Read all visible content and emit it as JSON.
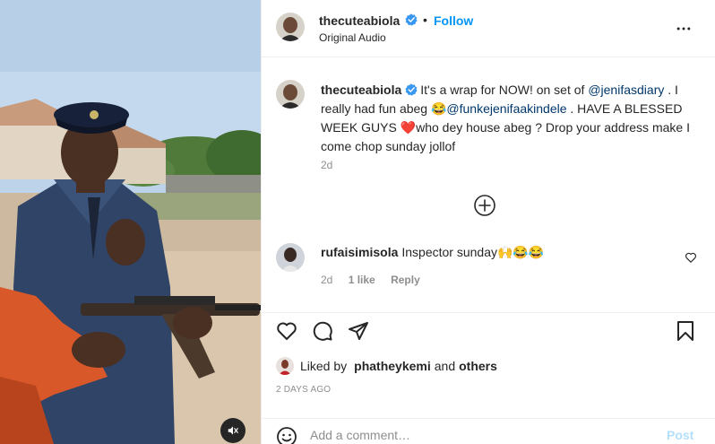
{
  "post": {
    "author": "thecuteabiola",
    "follow_label": "Follow",
    "separator": "•",
    "audio": "Original Audio",
    "more_icon": "more-horizontal-icon",
    "mute_icon": "speaker-muted-icon"
  },
  "caption": {
    "author": "thecuteabiola",
    "text_1": "It's a wrap for NOW! on set of ",
    "mention_1": "@jenifasdiary",
    "text_2": " . I really had fun abeg 😂",
    "mention_2": "@funkejenifaakindele",
    "text_3": " . HAVE A BLESSED WEEK GUYS ❤️who dey house abeg ? Drop your address make I come chop sunday jollof",
    "time": "2d",
    "load_more_icon": "plus-circle-icon"
  },
  "comment": {
    "author": "rufaisimisola",
    "text": "Inspector sunday🙌😂😂",
    "time": "2d",
    "likes": "1 like",
    "reply": "Reply",
    "like_icon": "heart-outline-icon"
  },
  "actions": {
    "like_icon": "heart-icon",
    "comment_icon": "comment-icon",
    "share_icon": "paper-plane-icon",
    "save_icon": "bookmark-icon"
  },
  "likes": {
    "prefix": "Liked by",
    "user": "phatheykemi",
    "connector": "and",
    "others": "others"
  },
  "age": "2 DAYS AGO",
  "add_comment": {
    "placeholder": "Add a comment…",
    "post_label": "Post",
    "emoji_icon": "emoji-smile-icon"
  },
  "colors": {
    "link_blue": "#0095f6",
    "mention_blue": "#00376b",
    "secondary": "#8e8e8e",
    "text": "#262626",
    "post_disabled": "#b2dffc"
  }
}
